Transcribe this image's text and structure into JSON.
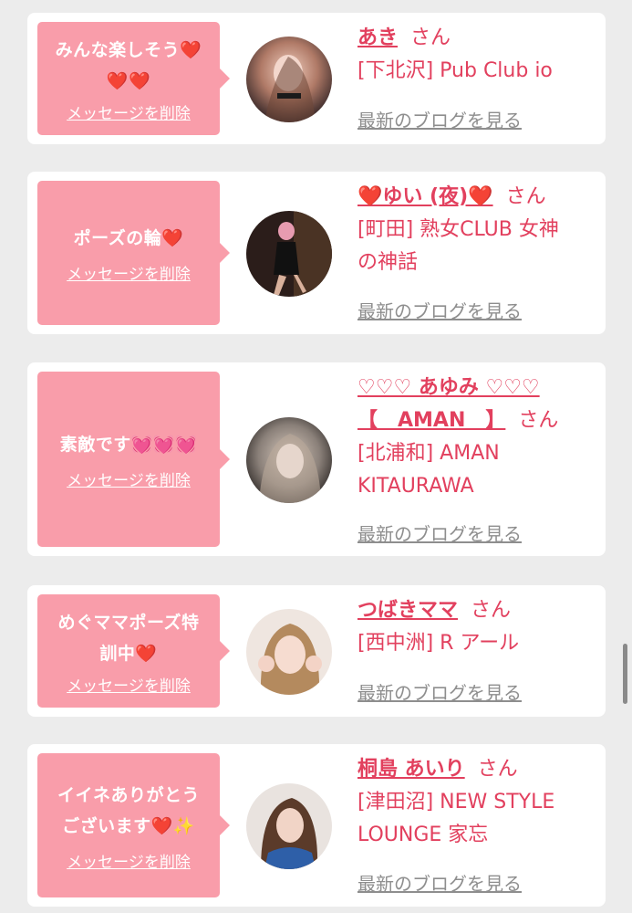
{
  "delete_label": "メッセージを削除",
  "blog_label": "最新のブログを見る",
  "san_label": "さん",
  "accent_color": "#e2405e",
  "bubble_color": "#f99daa",
  "items": [
    {
      "message_line1": "みんな楽しそう❤️",
      "message_line2": "❤️❤️",
      "name": "あき",
      "shop_line1": "[下北沢] Pub Club io",
      "shop_line2": ""
    },
    {
      "message_line1": "ポーズの輪❤️",
      "message_line2": "",
      "name": "❤️ゆい (夜)❤️",
      "shop_line1": "[町田] 熟女CLUB 女神",
      "shop_line2": "の神話"
    },
    {
      "message_line1": "素敵です💓💓💓",
      "message_line2": "",
      "name_line1": "♡♡♡ あゆみ ♡♡♡",
      "name_line2": "【　AMAN　】",
      "shop_line1": "[北浦和] AMAN",
      "shop_line2": "KITAURAWA"
    },
    {
      "message_line1": "めぐママポーズ特",
      "message_line2": "訓中❤️",
      "name": "つばきママ",
      "shop_line1": "[西中洲] R アール",
      "shop_line2": ""
    },
    {
      "message_line1": "イイネありがとう",
      "message_line2": "ございます❤️✨",
      "name": "桐島 あいり",
      "shop_line1": "[津田沼] NEW STYLE",
      "shop_line2": "LOUNGE 家忘"
    }
  ]
}
